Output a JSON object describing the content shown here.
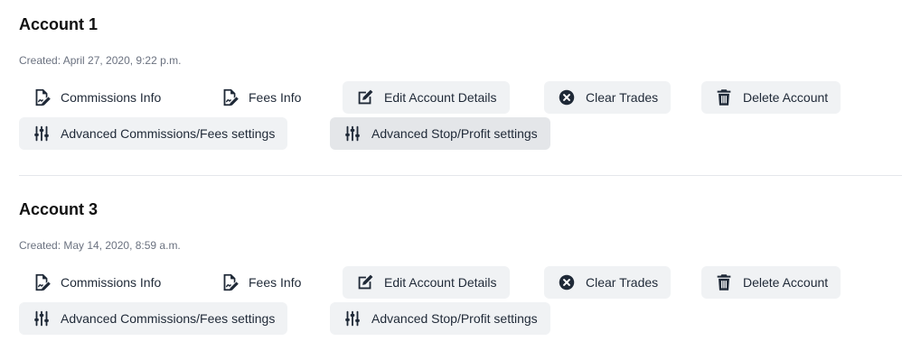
{
  "accounts": [
    {
      "title": "Account 1",
      "created": "Created: April 27, 2020, 9:22 p.m.",
      "buttons": {
        "commissions": "Commissions Info",
        "fees": "Fees Info",
        "edit": "Edit Account Details",
        "clear": "Clear Trades",
        "delete": "Delete Account",
        "adv_comm": "Advanced Commissions/Fees settings",
        "adv_stop": "Advanced Stop/Profit settings"
      }
    },
    {
      "title": "Account 3",
      "created": "Created: May 14, 2020, 8:59 a.m.",
      "buttons": {
        "commissions": "Commissions Info",
        "fees": "Fees Info",
        "edit": "Edit Account Details",
        "clear": "Clear Trades",
        "delete": "Delete Account",
        "adv_comm": "Advanced Commissions/Fees settings",
        "adv_stop": "Advanced Stop/Profit settings"
      }
    }
  ],
  "icons": {
    "commissions": "file-signature-icon",
    "fees": "file-signature-icon",
    "edit": "edit-icon",
    "clear": "times-circle-icon",
    "delete": "trash-icon",
    "adv_comm": "sliders-icon",
    "adv_stop": "sliders-icon"
  },
  "colors": {
    "button_bg": "#f0f2f4",
    "button_active_bg": "#e4e6e9",
    "icon": "#1f2937",
    "created_text": "#6b7280"
  }
}
